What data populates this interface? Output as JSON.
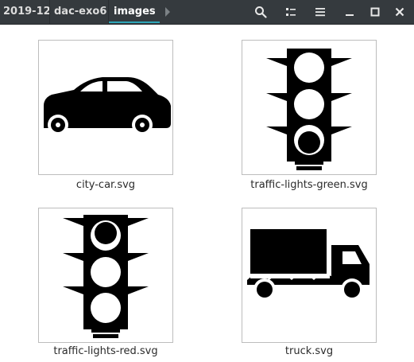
{
  "breadcrumb": {
    "items": [
      "2019-12",
      "dac-exo6",
      "images"
    ]
  },
  "header": {
    "buttons": [
      "search-icon",
      "view-toggle-icon",
      "menu-icon",
      "minimize-icon",
      "maximize-icon",
      "close-icon"
    ]
  },
  "files": [
    {
      "name": "city-car.svg",
      "icon": "car-icon"
    },
    {
      "name": "traffic-lights-green.svg",
      "icon": "traffic-light-icon"
    },
    {
      "name": "traffic-lights-red.svg",
      "icon": "traffic-light-icon"
    },
    {
      "name": "truck.svg",
      "icon": "truck-icon"
    }
  ],
  "colors": {
    "headerbar": "#353a3e",
    "accent": "#2ea6b8",
    "header_text": "#dcdcdc",
    "canvas": "#ffffff"
  }
}
